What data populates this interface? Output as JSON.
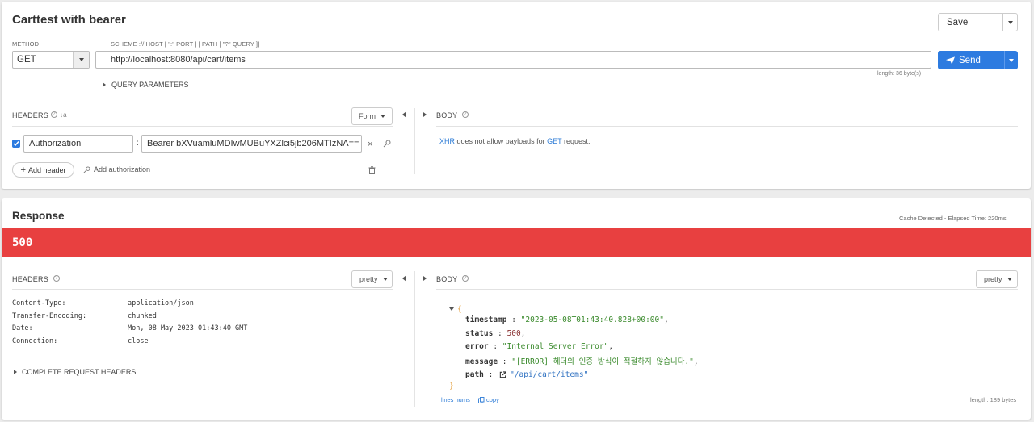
{
  "request": {
    "title": "Carttest with bearer",
    "save_label": "Save",
    "method_label": "METHOD",
    "method_value": "GET",
    "url_label": "SCHEME :// HOST [ \":\" PORT ] [ PATH [ \"?\" QUERY ]]",
    "url_value": "http://localhost:8080/api/cart/items",
    "length_text": "length: 36 byte(s)",
    "send_label": "Send",
    "query_params_label": "QUERY PARAMETERS",
    "headers_label": "HEADERS",
    "form_label": "Form",
    "header_row": {
      "key": "Authorization",
      "value": "Bearer bXVuamluMDIwMUBuYXZlci5jb206MTIzNA=="
    },
    "add_header_label": "Add header",
    "add_auth_label": "Add authorization",
    "body_label": "BODY",
    "body_note": {
      "xhr": "XHR",
      "mid": "does not allow payloads for",
      "get": "GET",
      "end": "request."
    }
  },
  "response": {
    "title": "Response",
    "meta": "Cache Detected - Elapsed Time: 220ms",
    "status_code": "500",
    "status_color": "#e84040",
    "headers_label": "HEADERS",
    "pretty_label": "pretty",
    "headers": [
      {
        "name": "Content-Type:",
        "value": "application/json"
      },
      {
        "name": "Transfer-Encoding:",
        "value": "chunked"
      },
      {
        "name": "Date:",
        "value": "Mon, 08 May 2023 01:43:40 GMT"
      },
      {
        "name": "Connection:",
        "value": "close"
      }
    ],
    "complete_headers_label": "COMPLETE REQUEST HEADERS",
    "body_label": "BODY",
    "json": {
      "open": "{",
      "close": "}",
      "fields": [
        {
          "key": "timestamp",
          "value": "\"2023-05-08T01:43:40.828+00:00\"",
          "trail": ",",
          "kind": "string"
        },
        {
          "key": "status",
          "value": "500",
          "trail": ",",
          "kind": "number"
        },
        {
          "key": "error",
          "value": "\"Internal Server Error\"",
          "trail": ",",
          "kind": "string"
        },
        {
          "key": "message",
          "value": "\"[ERROR] 헤더의 인증 방식이 적절하지 않습니다.\"",
          "trail": ",",
          "kind": "string"
        },
        {
          "key": "path",
          "value": "\"/api/cart/items\"",
          "trail": "",
          "kind": "link"
        }
      ]
    },
    "line_nums_label": "lines nums",
    "copy_label": "copy",
    "length_text": "length: 189 bytes"
  }
}
